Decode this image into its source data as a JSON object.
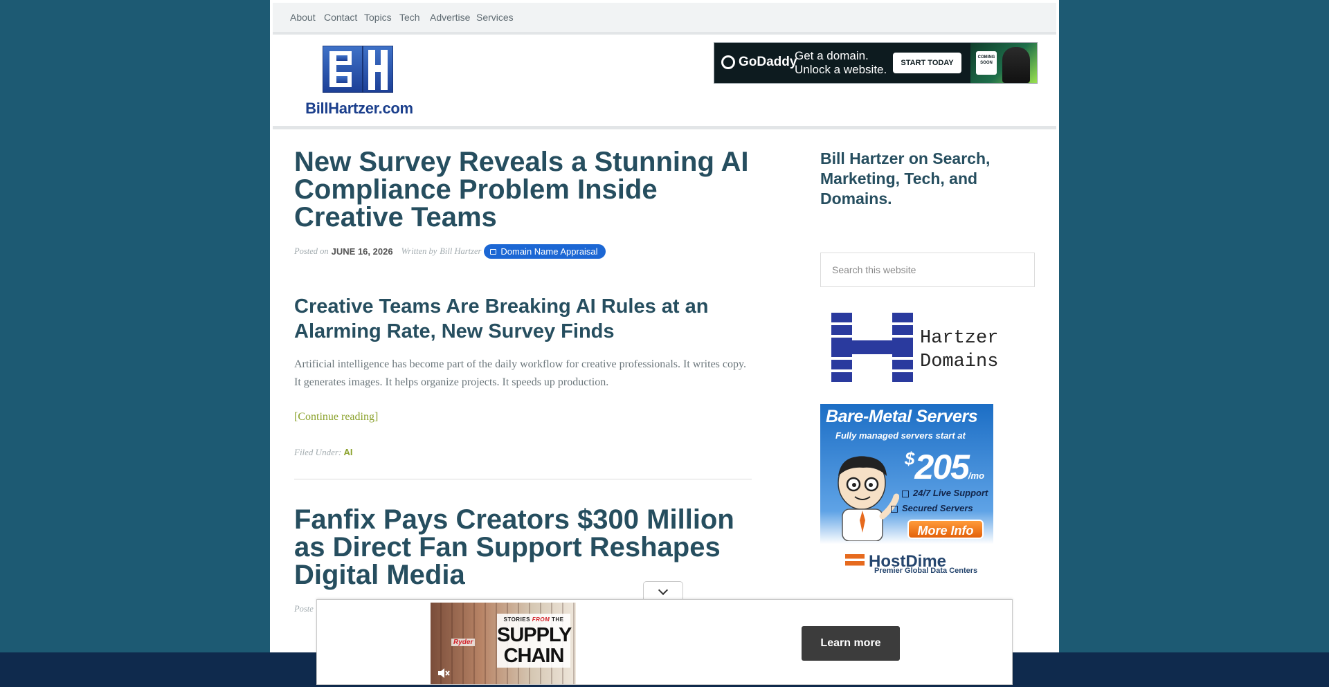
{
  "nav": {
    "items": [
      {
        "label": "About"
      },
      {
        "label": "Contact"
      },
      {
        "label": "Topics"
      },
      {
        "label": "Tech"
      },
      {
        "label": "Advertise"
      },
      {
        "label": "Services"
      }
    ]
  },
  "header": {
    "logo_text": "BillHartzer.com",
    "ad": {
      "brand": "GoDaddy",
      "tagline_line1": "Get a domain.",
      "tagline_line2": "Unlock a website.",
      "cta": "START TODAY",
      "badge": "COMING SOON"
    }
  },
  "posts": [
    {
      "title": "New Survey Reveals a Stunning AI Compliance Problem Inside Creative Teams",
      "posted_on_label": "Posted on",
      "date": "JUNE 16, 2026",
      "written_by_label": "Written by",
      "author": "Bill Hartzer",
      "badge": "Domain Name Appraisal",
      "subheading": "Creative Teams Are Breaking AI Rules at an Alarming Rate, New Survey Finds",
      "excerpt": "Artificial intelligence has become part of the daily workflow for creative professionals. It writes copy. It generates images. It helps organize projects. It speeds up production.",
      "continue_label": "[Continue reading]",
      "filed_under_label": "Filed Under:",
      "category": "AI"
    },
    {
      "title": "Fanfix Pays Creators $300 Million as Direct Fan Support Reshapes Digital Media",
      "meta_partial": "Poste"
    }
  ],
  "sidebar": {
    "widget_title": "Bill Hartzer on Search, Marketing, Tech, and Domains.",
    "search_placeholder": "Search this website",
    "hartzer_domains": {
      "line1": "Hartzer",
      "line2": "Domains"
    },
    "hostdime_ad": {
      "headline": "Bare-Metal Servers",
      "subline": "Fully managed servers start at",
      "currency": "$",
      "price": "205",
      "period": "/mo",
      "feature_1": "24/7 Live Support",
      "feature_2": "Secured Servers",
      "button": "More Info",
      "brand": "HostDime",
      "tagline": "Premier Global Data Centers"
    },
    "partial_ad_letter": "H"
  },
  "sticky_ad": {
    "video": {
      "small_line_pre": "STORIES",
      "small_line_from": "FROM",
      "small_line_post": "THE",
      "big_line1": "SUPPLY",
      "big_line2": "CHAIN",
      "logo": "Ryder"
    },
    "cta": "Learn more"
  },
  "colors": {
    "page_background": "#1d5a73",
    "bottom_strip": "#0f2a4d",
    "title": "#264e5f",
    "link_green": "#8ba22d",
    "badge_blue": "#1c67d4"
  },
  "icons": [
    "godaddy-logo-icon",
    "calendar-icon",
    "chevron-down-icon",
    "mute-icon"
  ]
}
